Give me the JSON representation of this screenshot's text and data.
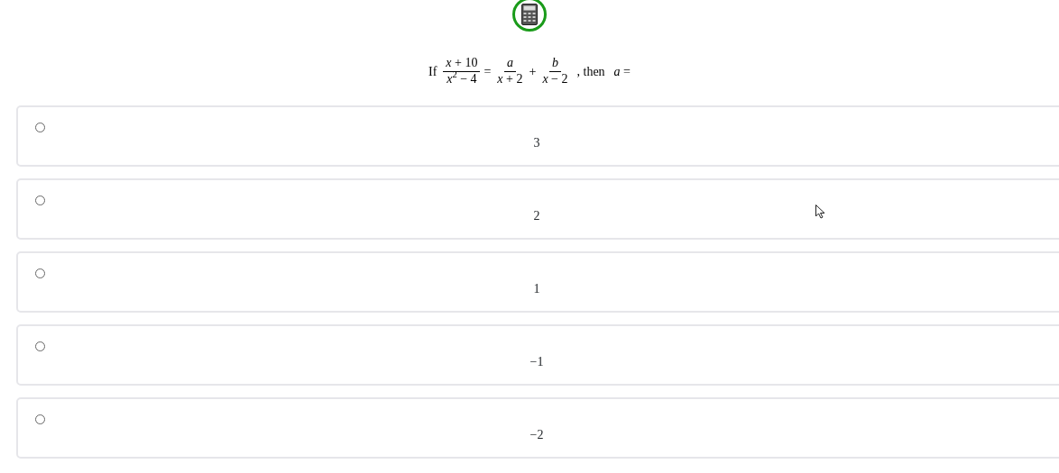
{
  "question": {
    "terms": [
      {
        "kind": "text",
        "text": "If"
      },
      {
        "kind": "fraction",
        "numerator": "*x* + 10",
        "denominator": "*x*$^{2}$ − 4"
      },
      {
        "kind": "operator",
        "text": "="
      },
      {
        "kind": "fraction",
        "numerator": "*a*",
        "denominator": "*x* + 2"
      },
      {
        "kind": "operator",
        "text": "+"
      },
      {
        "kind": "fraction",
        "numerator": "*b*",
        "denominator": "*x* − 2"
      },
      {
        "kind": "text",
        "text": ", then"
      },
      {
        "kind": "text",
        "text": "*a* ="
      }
    ]
  },
  "options": [
    {
      "value": "3",
      "selected": false
    },
    {
      "value": "2",
      "selected": false
    },
    {
      "value": "1",
      "selected": false
    },
    {
      "value": "−1",
      "selected": false
    },
    {
      "value": "−2",
      "selected": false
    }
  ]
}
